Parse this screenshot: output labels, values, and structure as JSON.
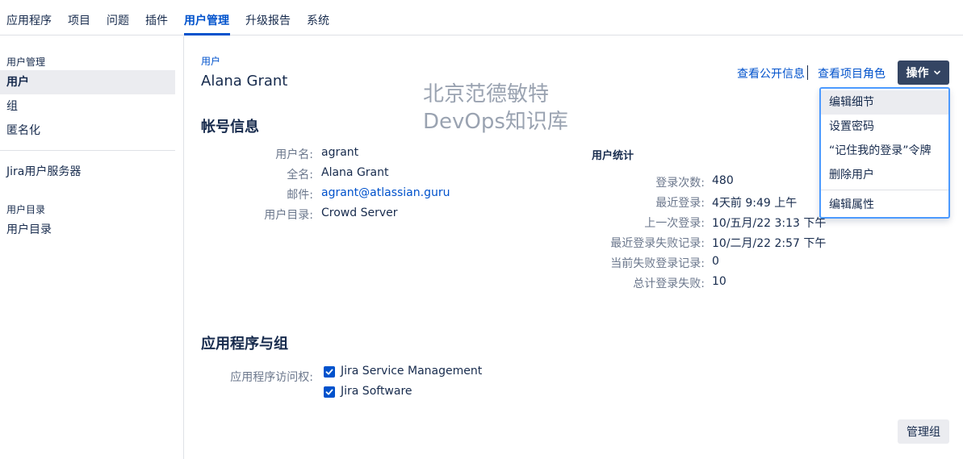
{
  "topnav": {
    "tabs": [
      "应用程序",
      "项目",
      "问题",
      "插件",
      "用户管理",
      "升级报告",
      "系统"
    ]
  },
  "sidebar": {
    "section1_heading": "用户管理",
    "items1": [
      "用户",
      "组",
      "匿名化"
    ],
    "jira_servers": "Jira用户服务器",
    "section2_heading": "用户目录",
    "items2": [
      "用户目录"
    ]
  },
  "main": {
    "breadcrumb": "用户",
    "title": "Alana Grant",
    "account": {
      "heading": "帐号信息",
      "fields": [
        {
          "label": "用户名:",
          "value": "agrant"
        },
        {
          "label": "全名:",
          "value": "Alana Grant"
        },
        {
          "label": "邮件:",
          "value": "agrant@atlassian.guru"
        },
        {
          "label": "用户目录:",
          "value": "Crowd Server"
        }
      ]
    },
    "stats": {
      "heading": "用户统计",
      "fields": [
        {
          "label": "登录次数:",
          "value": "480"
        },
        {
          "label": "最近登录:",
          "value": "4天前 9:49 上午"
        },
        {
          "label": "上一次登录:",
          "value": "10/五月/22 3:13 下午"
        },
        {
          "label": "最近登录失败记录:",
          "value": "10/二月/22 2:57 下午"
        },
        {
          "label": "当前失败登录记录:",
          "value": "0"
        },
        {
          "label": "总计登录失败:",
          "value": "10"
        }
      ]
    },
    "apps": {
      "heading": "应用程序与组",
      "label": "应用程序访问权:",
      "items": [
        "Jira Service Management",
        "Jira Software"
      ]
    },
    "links": {
      "public_info": "查看公开信息",
      "project_roles": "查看项目角色"
    },
    "ops_button": "操作",
    "dropdown": [
      "编辑细节",
      "设置密码",
      "“记住我的登录”令牌",
      "删除用户",
      "编辑属性"
    ],
    "manage_groups": "管理组"
  },
  "watermark": {
    "line1": "北京范德敏特",
    "line2": "DevOps知识库"
  },
  "colors": {
    "accent": "#0052cc",
    "ops_button_bg": "#344563",
    "dropdown_border": "#4c9aff"
  }
}
